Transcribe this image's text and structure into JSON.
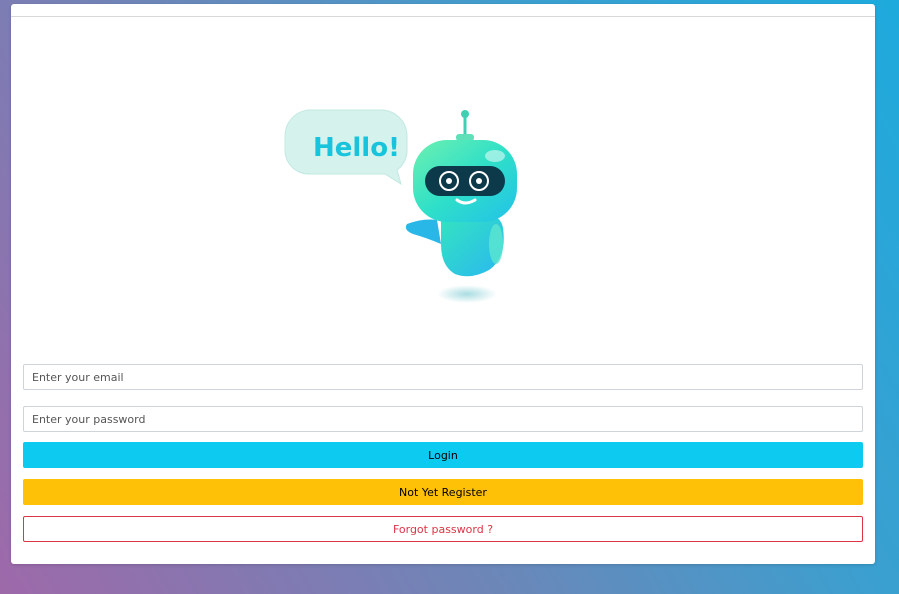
{
  "illustration": {
    "bubble_text": "Hello!"
  },
  "form": {
    "email_placeholder": "Enter your email",
    "password_placeholder": "Enter your password",
    "login_label": "Login",
    "register_label": "Not Yet Register",
    "forgot_label": "Forgot password ?"
  },
  "colors": {
    "login": "#0dcaf0",
    "register": "#ffc107",
    "forgot": "#dc3545"
  }
}
